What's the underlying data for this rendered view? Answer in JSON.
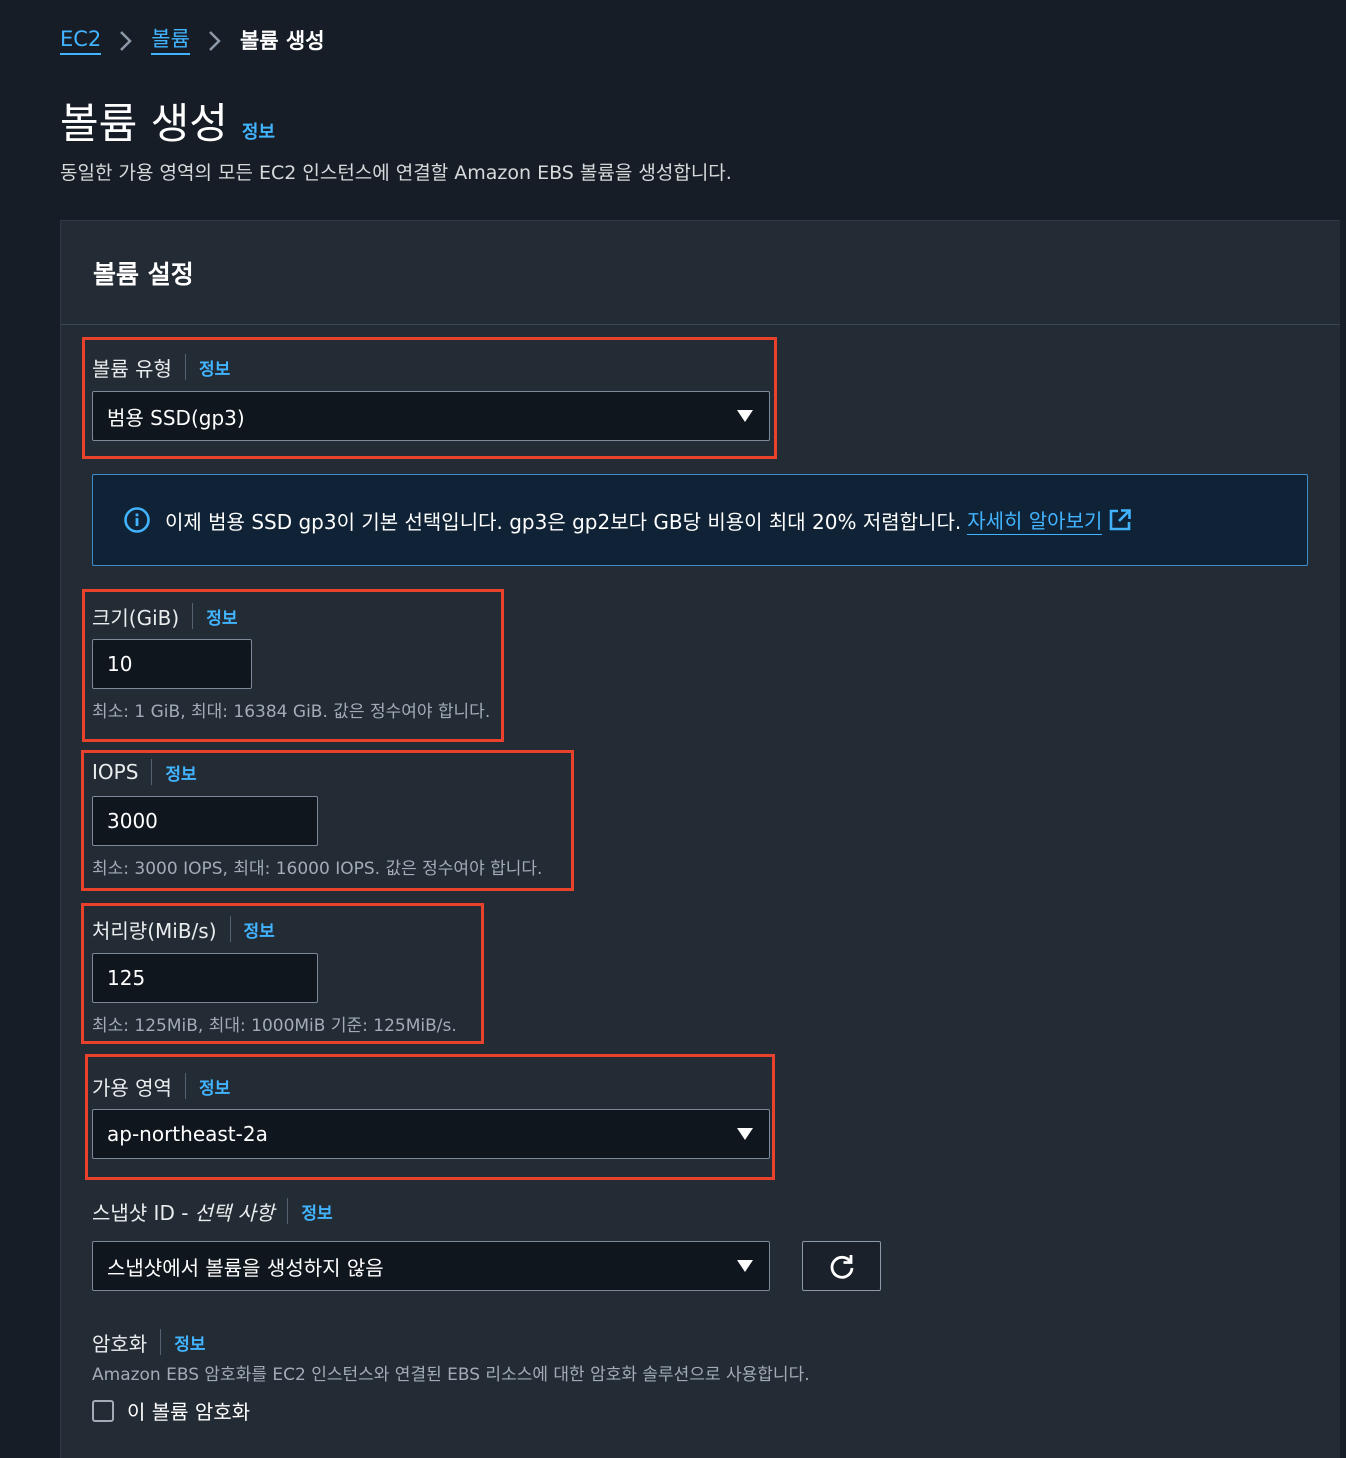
{
  "breadcrumb": {
    "items": [
      {
        "label": "EC2"
      },
      {
        "label": "볼륨"
      }
    ],
    "current": "볼륨 생성"
  },
  "page": {
    "title": "볼륨 생성",
    "info": "정보",
    "description": "동일한 가용 영역의 모든 EC2 인스턴스에 연결할 Amazon EBS 볼륨을 생성합니다."
  },
  "settings": {
    "title": "볼륨 설정",
    "volume_type": {
      "label": "볼륨 유형",
      "info": "정보",
      "value": "범용 SSD(gp3)"
    },
    "alert": {
      "text": "이제 범용 SSD gp3이 기본 선택입니다. gp3은 gp2보다 GB당 비용이 최대 20% 저렴합니다.",
      "link": "자세히 알아보기"
    },
    "size": {
      "label": "크기(GiB)",
      "info": "정보",
      "value": "10",
      "hint": "최소: 1 GiB, 최대: 16384 GiB. 값은 정수여야 합니다."
    },
    "iops": {
      "label": "IOPS",
      "info": "정보",
      "value": "3000",
      "hint": "최소: 3000 IOPS, 최대: 16000 IOPS. 값은 정수여야 합니다."
    },
    "throughput": {
      "label": "처리량(MiB/s)",
      "info": "정보",
      "value": "125",
      "hint": "최소: 125MiB, 최대: 1000MiB 기준: 125MiB/s."
    },
    "availability_zone": {
      "label": "가용 영역",
      "info": "정보",
      "value": "ap-northeast-2a"
    },
    "snapshot": {
      "label": "스냅샷 ID -",
      "optional": "선택 사항",
      "info": "정보",
      "value": "스냅샷에서 볼륨을 생성하지 않음"
    },
    "encryption": {
      "label": "암호화",
      "info": "정보",
      "description": "Amazon EBS 암호화를 EC2 인스턴스와 연결된 EBS 리소스에 대한 암호화 솔루션으로 사용합니다.",
      "checkbox_label": "이 볼륨 암호화",
      "checked": false
    }
  },
  "colors": {
    "highlight": "#e8412c",
    "link": "#42b4ff",
    "background": "#161d26"
  }
}
